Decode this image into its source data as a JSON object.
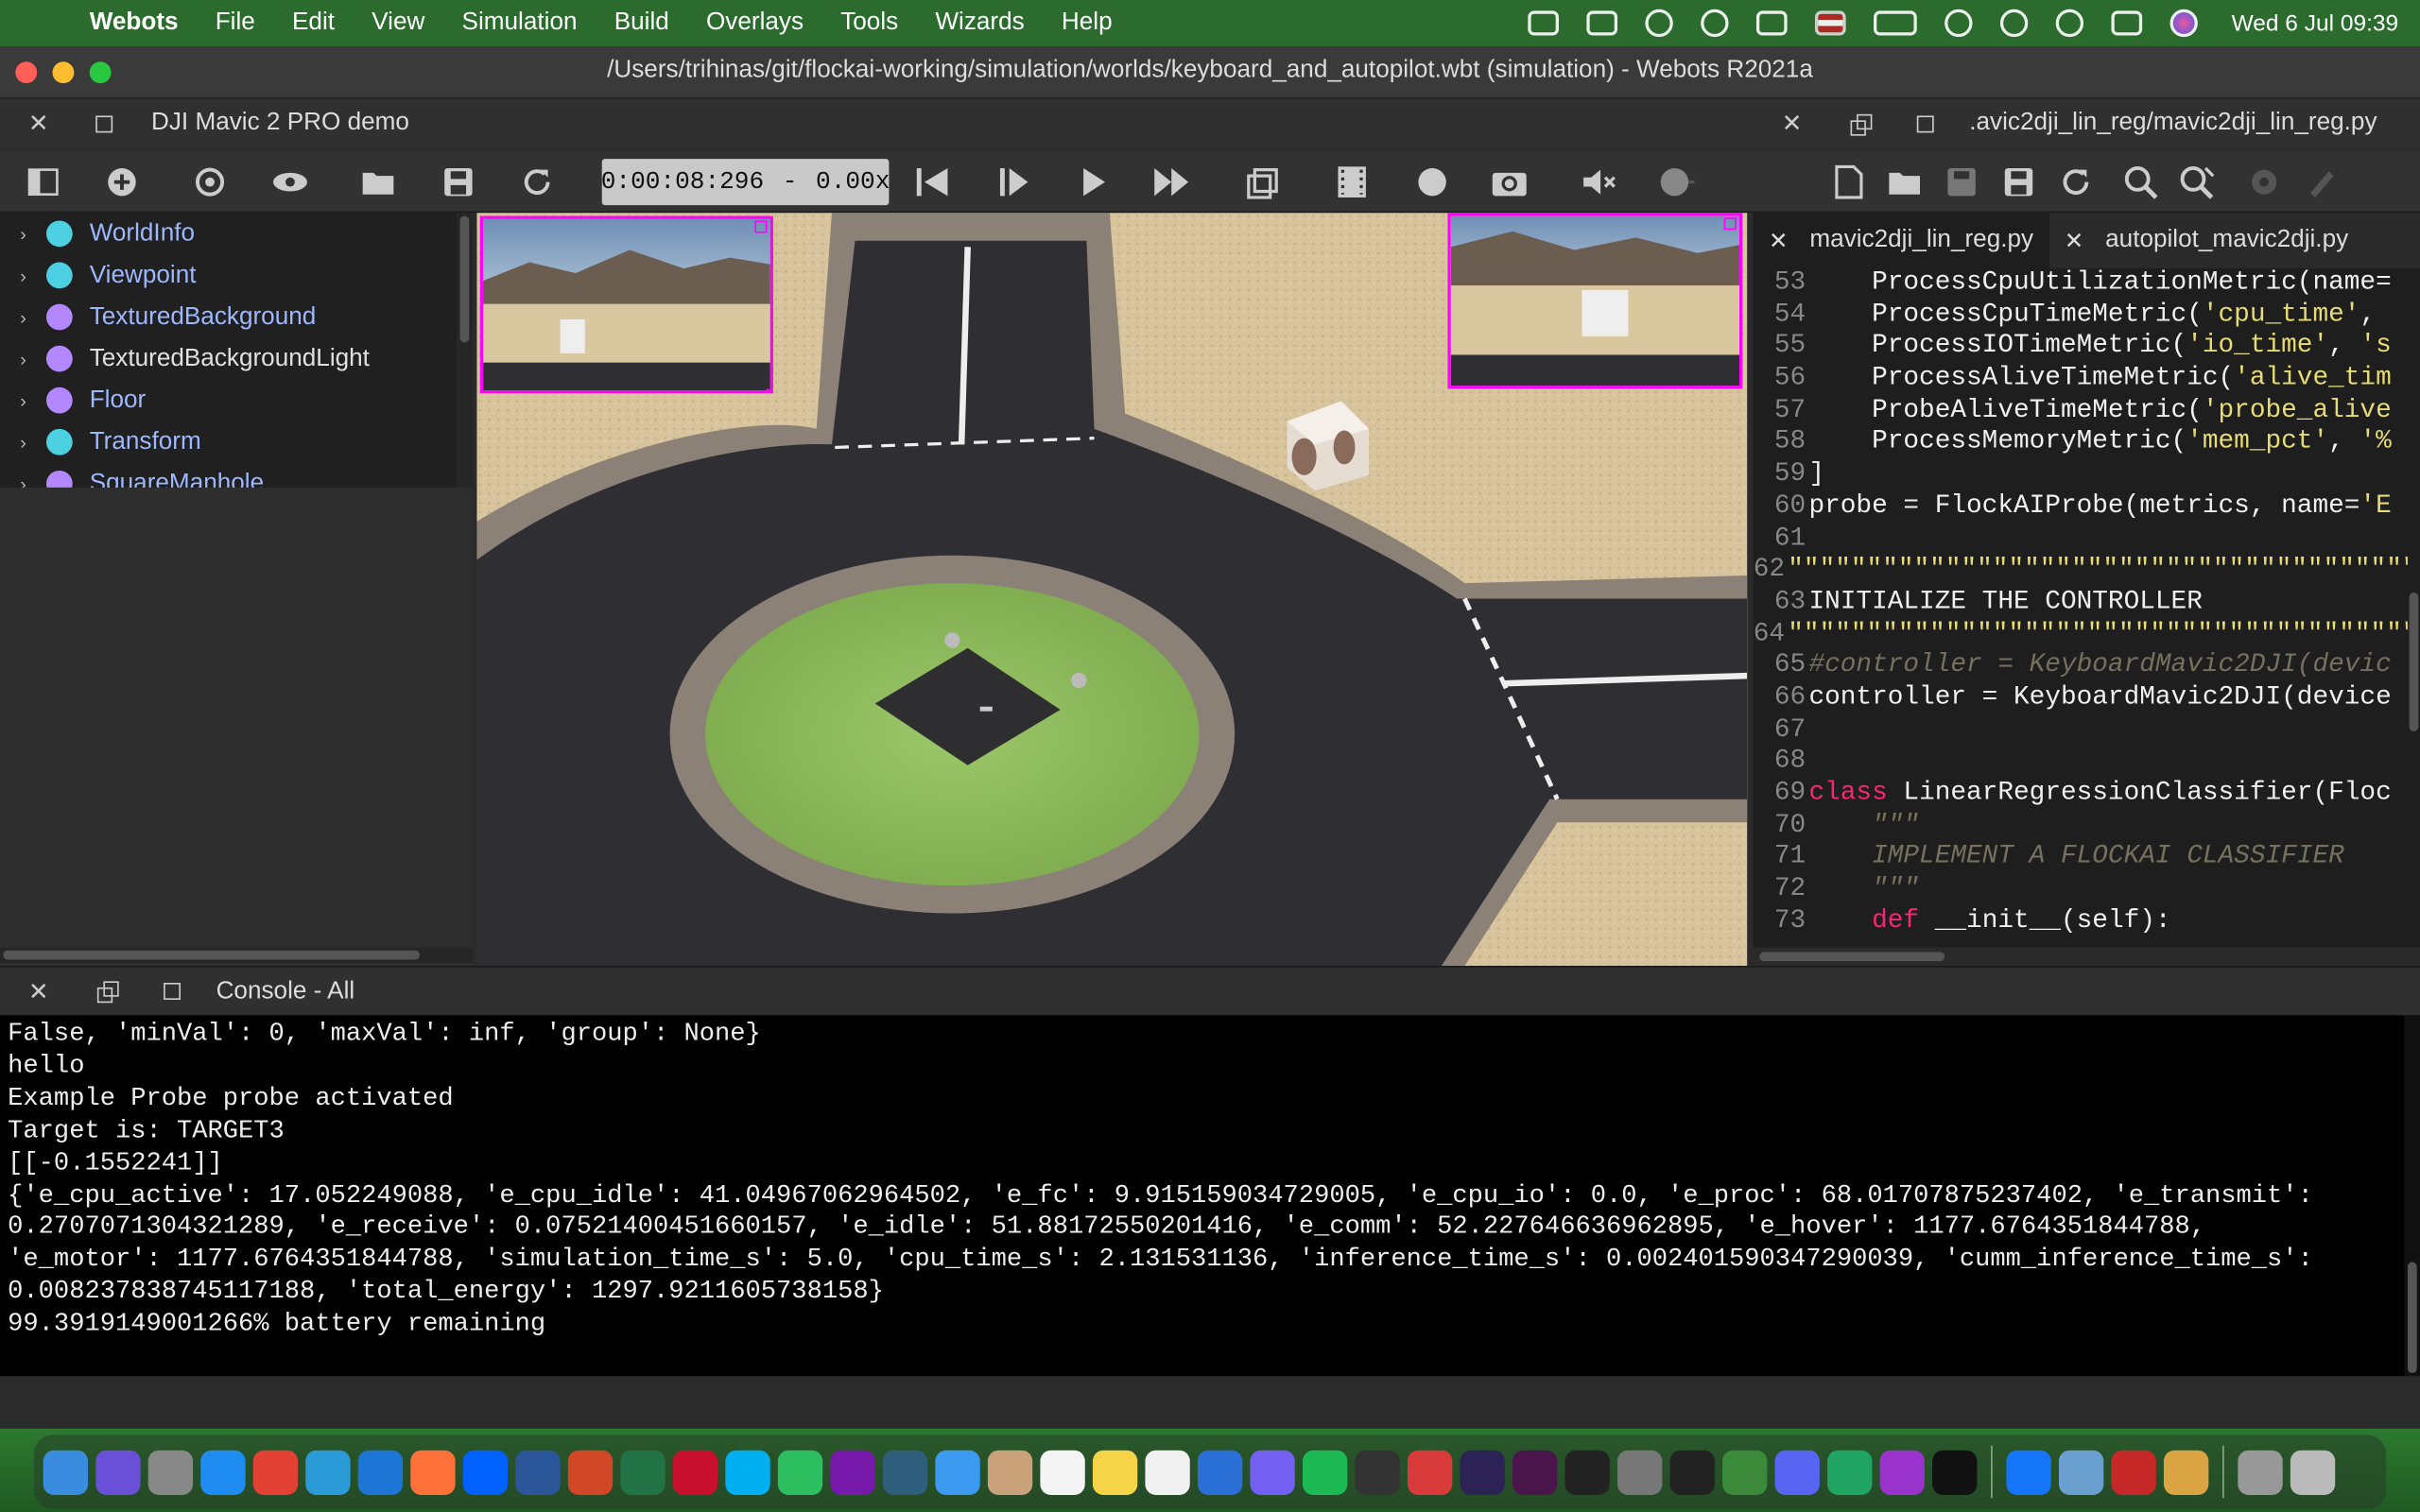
{
  "menubar": {
    "app_name": "Webots",
    "items": [
      "File",
      "Edit",
      "View",
      "Simulation",
      "Build",
      "Overlays",
      "Tools",
      "Wizards",
      "Help"
    ],
    "clock": "Wed 6 Jul  09:39",
    "status_icons": [
      "dropbox-icon",
      "drive-icon",
      "vpn-icon",
      "evernote-icon",
      "screens-icon",
      "us-flag-icon",
      "battery-icon",
      "wifi-icon",
      "user-icon",
      "spotlight-search-icon",
      "control-center-icon",
      "siri-icon"
    ]
  },
  "window": {
    "title": "/Users/trihinas/git/flockai-working/simulation/worlds/keyboard_and_autopilot.wbt (simulation) - Webots R2021a"
  },
  "scene_panel": {
    "title": "DJI Mavic 2 PRO demo"
  },
  "editor_panel": {
    "title": ".avic2dji_lin_reg/mavic2dji_lin_reg.py"
  },
  "toolbar": {
    "time": "0:00:08:296",
    "separator": "-",
    "speed": "0.00x",
    "left_icons": [
      "toggle-scene-tree-icon",
      "add-node-icon",
      "orbit-view-icon",
      "eye-icon",
      "open-world-icon",
      "save-world-icon",
      "reload-world-icon"
    ],
    "playback_icons": [
      "reset-simulation-icon",
      "step-icon",
      "play-icon",
      "fast-forward-icon",
      "perspective-icon",
      "movie-icon",
      "record-icon",
      "screenshot-icon",
      "mute-icon",
      "volume-icon"
    ],
    "editor_icons": [
      "new-file-icon",
      "open-file-icon",
      "save-file-icon",
      "save-as-icon",
      "revert-icon",
      "find-icon",
      "find-replace-icon",
      "build-icon",
      "clean-icon"
    ]
  },
  "scene_tree": {
    "items": [
      {
        "label": "WorldInfo",
        "color": "#4dd0e1",
        "style": "proto"
      },
      {
        "label": "Viewpoint",
        "color": "#4dd0e1",
        "style": "proto"
      },
      {
        "label": "TexturedBackground",
        "color": "#b388ff",
        "style": "proto"
      },
      {
        "label": "TexturedBackgroundLight",
        "color": "#b388ff",
        "style": "light"
      },
      {
        "label": "Floor",
        "color": "#b388ff",
        "style": "proto"
      },
      {
        "label": "Transform",
        "color": "#4dd0e1",
        "style": "proto"
      },
      {
        "label": "SquareManhole",
        "color": "#b388ff",
        "style": "proto"
      }
    ]
  },
  "editor": {
    "tabs": [
      {
        "label": "mavic2dji_lin_reg.py",
        "active": true
      },
      {
        "label": "autopilot_mavic2dji.py",
        "active": false
      }
    ],
    "lines": [
      {
        "n": "53",
        "parts": [
          [
            "fn",
            "    ProcessCpuUtilizationMetric(name="
          ]
        ]
      },
      {
        "n": "54",
        "parts": [
          [
            "fn",
            "    ProcessCpuTimeMetric("
          ],
          [
            "str",
            "'cpu_time'"
          ],
          [
            "fn",
            ","
          ]
        ]
      },
      {
        "n": "55",
        "parts": [
          [
            "fn",
            "    ProcessIOTimeMetric("
          ],
          [
            "str",
            "'io_time'"
          ],
          [
            "fn",
            ", "
          ],
          [
            "str",
            "'s"
          ]
        ]
      },
      {
        "n": "56",
        "parts": [
          [
            "fn",
            "    ProcessAliveTimeMetric("
          ],
          [
            "str",
            "'alive_tim"
          ]
        ]
      },
      {
        "n": "57",
        "parts": [
          [
            "fn",
            "    ProbeAliveTimeMetric("
          ],
          [
            "str",
            "'probe_alive"
          ]
        ]
      },
      {
        "n": "58",
        "parts": [
          [
            "fn",
            "    ProcessMemoryMetric("
          ],
          [
            "str",
            "'mem_pct'"
          ],
          [
            "fn",
            ", "
          ],
          [
            "str",
            "'%"
          ]
        ]
      },
      {
        "n": "59",
        "parts": [
          [
            "fn",
            "]"
          ]
        ]
      },
      {
        "n": "60",
        "parts": [
          [
            "fn",
            "probe = FlockAIProbe(metrics, name="
          ],
          [
            "str",
            "'E"
          ]
        ]
      },
      {
        "n": "61",
        "parts": []
      },
      {
        "n": "62",
        "parts": [
          [
            "str",
            "\"\"\"\"\"\"\"\"\"\"\"\"\"\"\"\"\"\"\"\"\"\"\"\"\"\"\"\"\"\"\"\"\"\"\"\"\"\"\"\"\"\"\"\"\"\"\"\"\""
          ]
        ]
      },
      {
        "n": "63",
        "parts": [
          [
            "fn",
            "INITIALIZE THE CONTROLLER"
          ]
        ]
      },
      {
        "n": "64",
        "parts": [
          [
            "str",
            "\"\"\"\"\"\"\"\"\"\"\"\"\"\"\"\"\"\"\"\"\"\"\"\"\"\"\"\"\"\"\"\"\"\"\"\"\"\"\"\"\"\"\"\"\"\"\"\"\""
          ]
        ]
      },
      {
        "n": "65",
        "parts": [
          [
            "cm",
            "#controller = KeyboardMavic2DJI(devic"
          ]
        ]
      },
      {
        "n": "66",
        "parts": [
          [
            "fn",
            "controller = KeyboardMavic2DJI(device"
          ]
        ]
      },
      {
        "n": "67",
        "parts": []
      },
      {
        "n": "68",
        "parts": []
      },
      {
        "n": "69",
        "parts": [
          [
            "kw",
            "class"
          ],
          [
            "fn",
            " LinearRegressionClassifier(Floc"
          ]
        ]
      },
      {
        "n": "70",
        "parts": [
          [
            "cm",
            "    \"\"\""
          ]
        ]
      },
      {
        "n": "71",
        "parts": [
          [
            "cm",
            "    IMPLEMENT A FLOCKAI CLASSIFIER"
          ]
        ]
      },
      {
        "n": "72",
        "parts": [
          [
            "cm",
            "    \"\"\""
          ]
        ]
      },
      {
        "n": "73",
        "parts": [
          [
            "kw",
            "    def"
          ],
          [
            "fn",
            " __init__(self):"
          ]
        ]
      }
    ]
  },
  "console": {
    "title": "Console - All",
    "lines": [
      "False, 'minVal': 0, 'maxVal': inf, 'group': None}",
      "hello",
      "Example Probe probe activated",
      "Target is: TARGET3",
      "[[-0.1552241]]",
      "{'e_cpu_active': 17.052249088, 'e_cpu_idle': 41.04967062964502, 'e_fc': 9.915159034729005, 'e_cpu_io': 0.0, 'e_proc': 68.01707875237402, 'e_transmit':",
      "0.2707071304321289, 'e_receive': 0.07521400451660157, 'e_idle': 51.88172550201416, 'e_comm': 52.227646636962895, 'e_hover': 1177.6764351844788,",
      "'e_motor': 1177.6764351844788, 'simulation_time_s': 5.0, 'cpu_time_s': 2.131531136, 'inference_time_s': 0.002401590347290039, 'cumm_inference_time_s':",
      "0.008237838745117188, 'total_energy': 1297.9211605738158}",
      "99.3919149001266% battery remaining"
    ]
  },
  "dock": {
    "apps": [
      {
        "name": "finder-icon",
        "color": "#3a8dde"
      },
      {
        "name": "siri-icon",
        "color": "#6a4fd8"
      },
      {
        "name": "launchpad-icon",
        "color": "#888"
      },
      {
        "name": "app-store-icon",
        "color": "#1e8cf0"
      },
      {
        "name": "chrome-icon",
        "color": "#e34133"
      },
      {
        "name": "whatsapp-web-icon",
        "color": "#2a9bd6"
      },
      {
        "name": "safari-icon",
        "color": "#1d76d6"
      },
      {
        "name": "firefox-icon",
        "color": "#ff7139"
      },
      {
        "name": "dropbox-icon",
        "color": "#0061ff"
      },
      {
        "name": "word-icon",
        "color": "#2b579a"
      },
      {
        "name": "powerpoint-icon",
        "color": "#d24726"
      },
      {
        "name": "excel-icon",
        "color": "#217346"
      },
      {
        "name": "mendeley-icon",
        "color": "#c8102e"
      },
      {
        "name": "skype-icon",
        "color": "#00aff0"
      },
      {
        "name": "evernote-icon",
        "color": "#2dbe60"
      },
      {
        "name": "onenote-icon",
        "color": "#7719aa"
      },
      {
        "name": "texshop-icon",
        "color": "#2f5d7c"
      },
      {
        "name": "mail-icon",
        "color": "#3c9af0"
      },
      {
        "name": "contacts-icon",
        "color": "#c9a27a"
      },
      {
        "name": "calendar-icon",
        "color": "#f4f4f4"
      },
      {
        "name": "notes-icon",
        "color": "#f5d547"
      },
      {
        "name": "reminders-icon",
        "color": "#f0f0f0"
      },
      {
        "name": "appstore2-icon",
        "color": "#2a6fd6"
      },
      {
        "name": "viber-icon",
        "color": "#7360f2"
      },
      {
        "name": "spotify-icon",
        "color": "#1db954"
      },
      {
        "name": "screens-icon",
        "color": "#333"
      },
      {
        "name": "parallels-icon",
        "color": "#d93a3a"
      },
      {
        "name": "eclipse-icon",
        "color": "#2c2255"
      },
      {
        "name": "slack-icon",
        "color": "#4a154b"
      },
      {
        "name": "terminal-icon",
        "color": "#222"
      },
      {
        "name": "system-preferences-icon",
        "color": "#777"
      },
      {
        "name": "activity-monitor-icon",
        "color": "#222"
      },
      {
        "name": "webots-icon",
        "color": "#3a8a3a"
      },
      {
        "name": "discord-icon",
        "color": "#5865f2"
      },
      {
        "name": "google-drive-icon",
        "color": "#1fa463"
      },
      {
        "name": "podcasts-icon",
        "color": "#9933cc"
      },
      {
        "name": "apple-tv-icon",
        "color": "#111"
      },
      {
        "name": "xcode-icon",
        "color": "#1575f9"
      },
      {
        "name": "preview-icon",
        "color": "#6aa0d0"
      },
      {
        "name": "bug-icon",
        "color": "#c62828"
      },
      {
        "name": "archive-icon",
        "color": "#d9a441"
      },
      {
        "name": "help-icon",
        "color": "#999"
      },
      {
        "name": "trash-icon",
        "color": "#bbb"
      }
    ]
  }
}
